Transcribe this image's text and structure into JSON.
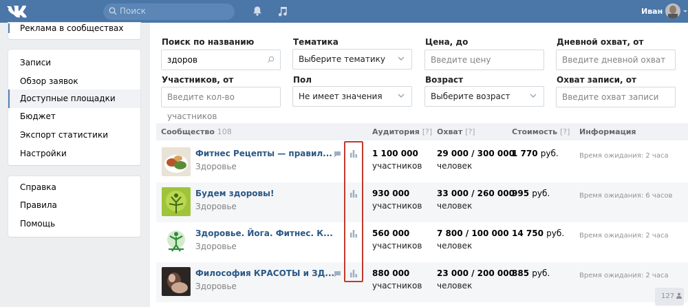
{
  "topbar": {
    "search_placeholder": "Поиск",
    "user_name": "Иван",
    "icons": {
      "logo": "vk-logo",
      "search": "search-icon",
      "notifications": "bell-icon",
      "music": "music-icon"
    }
  },
  "sidebar": {
    "top_item": "Реклама в сообществах",
    "main_items": [
      {
        "label": "Записи"
      },
      {
        "label": "Обзор заявок"
      },
      {
        "label": "Доступные площадки"
      },
      {
        "label": "Бюджет"
      },
      {
        "label": "Экспорт статистики"
      },
      {
        "label": "Настройки"
      }
    ],
    "active_item": "Доступные площадки",
    "help_items": [
      {
        "label": "Справка"
      },
      {
        "label": "Правила"
      },
      {
        "label": "Помощь"
      }
    ]
  },
  "filters": {
    "name": {
      "label": "Поиск по названию",
      "value": "здоров"
    },
    "topic": {
      "label": "Тематика",
      "value": "Выберите тематику"
    },
    "price": {
      "label": "Цена, до",
      "placeholder": "Введите цену"
    },
    "daily_reach": {
      "label": "Дневной охват, от",
      "placeholder": "Введите дневной охват"
    },
    "members": {
      "label": "Участников, от",
      "placeholder": "Введите кол-во участников"
    },
    "gender": {
      "label": "Пол",
      "value": "Не имеет значения"
    },
    "age": {
      "label": "Возраст",
      "value": "Выберите возраст"
    },
    "post_reach": {
      "label": "Охват записи, от",
      "placeholder": "Введите охват записи"
    }
  },
  "table": {
    "headers": {
      "community": "Сообщество",
      "community_count": "108",
      "audience": "Аудитория",
      "reach": "Охват",
      "cost": "Стоимость",
      "info": "Информация",
      "help_mark": "[?]"
    },
    "rows": [
      {
        "name": "Фитнес Рецепты — правил...",
        "category": "Здоровье",
        "audience": "1 100 000",
        "audience_unit": "участников",
        "reach": "29 000 / 300 000",
        "reach_unit": "человек",
        "cost": "1 770",
        "cost_unit": "руб.",
        "info": "Время ожидания: 2 часа"
      },
      {
        "name": "Будем здоровы!",
        "category": "Здоровье",
        "audience": "930 000",
        "audience_unit": "участников",
        "reach": "33 000 / 260 000",
        "reach_unit": "человек",
        "cost": "995",
        "cost_unit": "руб.",
        "info": "Время ожидания: 6 часов"
      },
      {
        "name": "Здоровье. Йога. Фитнес. К...",
        "category": "Здоровье",
        "audience": "560 000",
        "audience_unit": "участников",
        "reach": "7 800 / 100 000",
        "reach_unit": "человек",
        "cost": "14 750",
        "cost_unit": "руб.",
        "info": "Время ожидания: 2 часа"
      },
      {
        "name": "Философия КРАСОТЫ и ЗД...",
        "category": "Здоровье",
        "audience": "880 000",
        "audience_unit": "участников",
        "reach": "23 000 / 200 000",
        "reach_unit": "человек",
        "cost": "885",
        "cost_unit": "руб.",
        "info": "Время ожидания: 2 часа"
      }
    ]
  },
  "page_counter": "127",
  "colors": {
    "brand": "#4a76a8",
    "link": "#2a5885",
    "highlight": "#c0392b"
  }
}
